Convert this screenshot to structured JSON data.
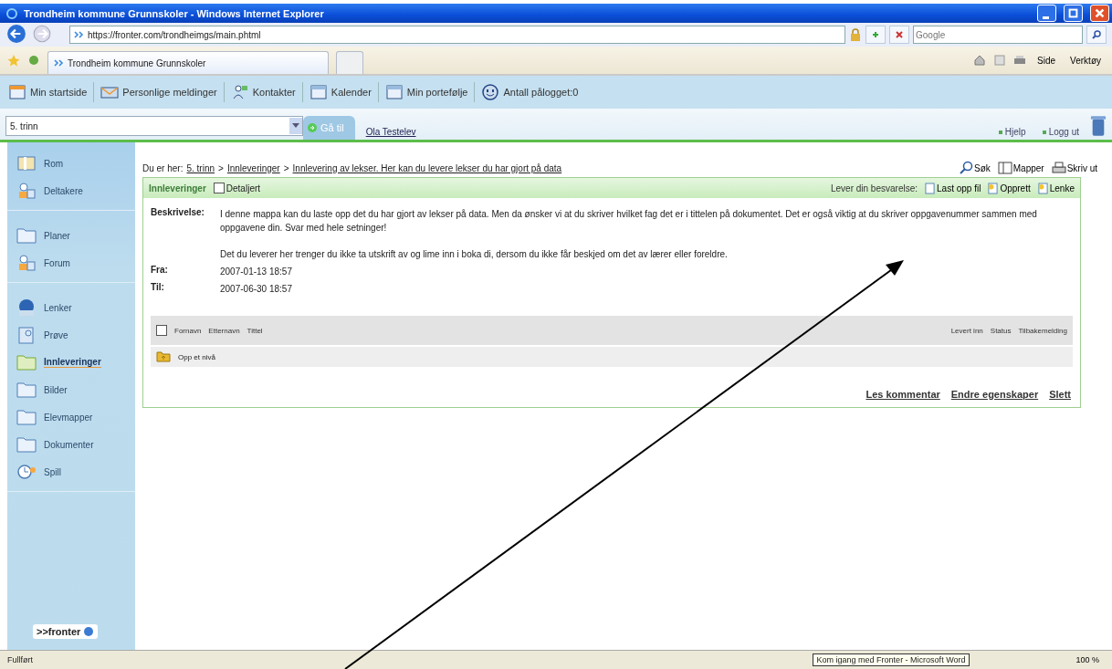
{
  "window": {
    "title": "Trondheim kommune Grunnskoler - Windows Internet Explorer"
  },
  "address_bar": {
    "url": "https://fronter.com/trondheimgs/main.phtml",
    "search_placeholder": "Google"
  },
  "browser_tab": {
    "label": "Trondheim kommune Grunnskoler"
  },
  "command_bar": [
    "Side",
    "Verktøy"
  ],
  "toolbar": [
    "Min startside",
    "Personlige meldinger",
    "Kontakter",
    "Kalender",
    "Min portefølje",
    "Antall pålogget:0"
  ],
  "room_bar": {
    "room": "5. trinn",
    "go": "Gå til",
    "user": "Ola Testelev",
    "links": [
      "Hjelp",
      "Logg ut"
    ]
  },
  "sidebar": {
    "groups": [
      [
        {
          "label": "Rom",
          "selected": false
        },
        {
          "label": "Deltakere",
          "selected": false
        }
      ],
      [
        {
          "label": "Planer",
          "selected": false
        },
        {
          "label": "Forum",
          "selected": false
        }
      ],
      [
        {
          "label": "Lenker",
          "selected": false
        },
        {
          "label": "Prøve",
          "selected": false
        },
        {
          "label": "Innleveringer",
          "selected": true
        },
        {
          "label": "Bilder",
          "selected": false
        },
        {
          "label": "Elevmapper",
          "selected": false
        },
        {
          "label": "Dokumenter",
          "selected": false
        },
        {
          "label": "Spill",
          "selected": false
        }
      ]
    ],
    "logo": ">>fronter"
  },
  "breadcrumb": {
    "prefix": "Du er her:",
    "separators": [
      ">",
      ">"
    ],
    "links": [
      "5. trinn",
      "Innleveringer",
      "Innlevering av lekser. Her kan du levere lekser du har gjort på data"
    ]
  },
  "page_actions": [
    "Søk",
    "Mapper",
    "Skriv ut"
  ],
  "panel": {
    "title": "Innleveringer",
    "detailed": {
      "label": "Detaljert",
      "checked": false
    },
    "submit_label": "Lever din besvarelse:",
    "submit_actions": [
      "Last opp fil",
      "Opprett",
      "Lenke"
    ],
    "fields": [
      {
        "label": "Beskrivelse:",
        "paragraphs": [
          "I denne mappa kan du laste opp det du har gjort av lekser på data. Men da ønsker vi at du skriver hvilket fag det er i tittelen på dokumentet. Det er også viktig at du skriver oppgavenummer sammen med oppgavene din. Svar med hele setninger!",
          "Det du leverer her trenger du ikke ta utskrift av og lime inn i boka di, dersom du ikke får beskjed om det av lærer eller foreldre."
        ]
      },
      {
        "label": "Fra:",
        "paragraphs": [
          "2007-01-13 18:57"
        ]
      },
      {
        "label": "Til:",
        "paragraphs": [
          "2007-06-30 18:57"
        ]
      }
    ],
    "table": {
      "columns_left": [
        "Fornavn",
        "Etternavn",
        "Tittel"
      ],
      "columns_right": [
        "Levert inn",
        "Status",
        "Tilbakemelding"
      ],
      "select_all": false,
      "rows": [
        {
          "label": "Opp et nivå"
        }
      ]
    },
    "footer_links": [
      "Les kommentar",
      "Endre egenskaper",
      "Slett"
    ]
  },
  "status_bar": {
    "text": "Fullført",
    "taskbar_tooltip": "Kom igang med Fronter - Microsoft Word",
    "zoom": "100 %"
  }
}
